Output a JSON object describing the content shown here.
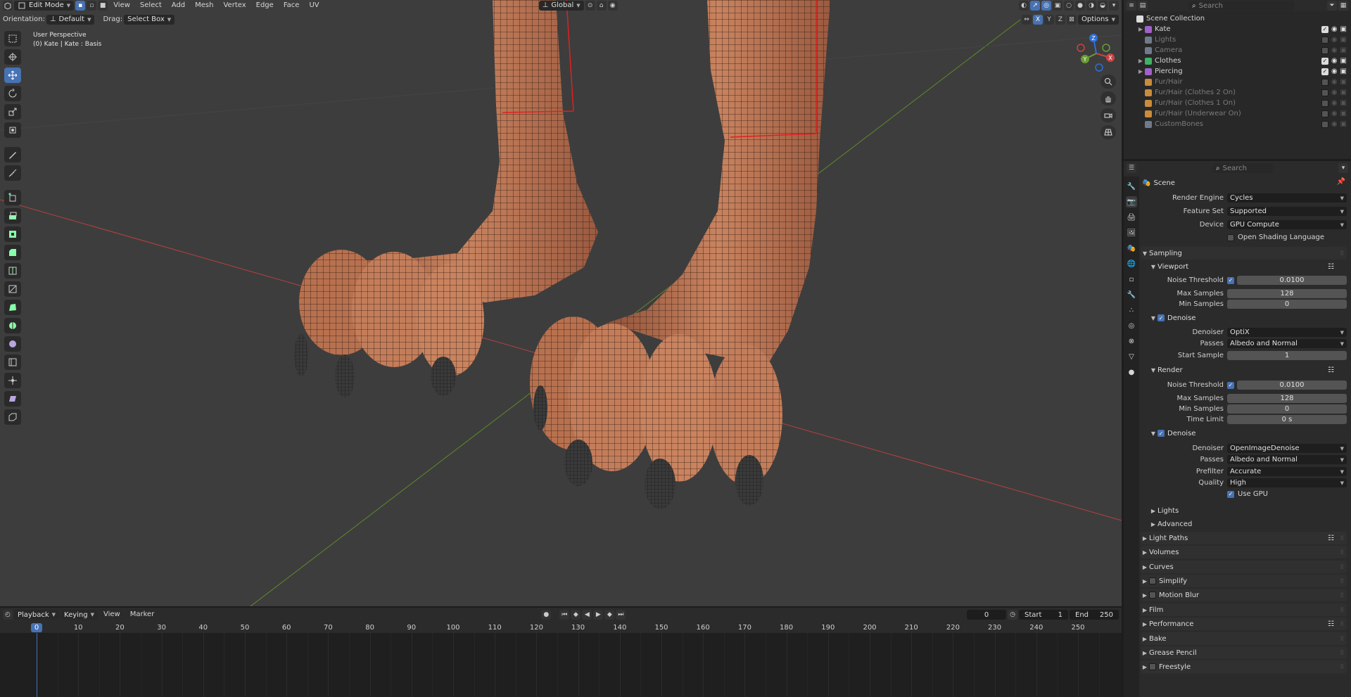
{
  "viewport": {
    "header": {
      "editor_icon": "cube-icon",
      "mode": "Edit Mode",
      "menus": [
        "View",
        "Select",
        "Add",
        "Mesh",
        "Vertex",
        "Edge",
        "Face",
        "UV"
      ],
      "transform_orientation": "Global"
    },
    "tool_header": {
      "orientation_label": "Orientation:",
      "orientation_value": "Default",
      "drag_label": "Drag:",
      "drag_value": "Select Box",
      "options_label": "Options",
      "mirror_x": "X",
      "mirror_y": "Y",
      "mirror_z": "Z"
    },
    "overlay": {
      "perspective": "User Perspective",
      "object_info": "(0) Kate | Kate : Basis"
    },
    "gizmo": {
      "x": "X",
      "y": "Y",
      "z": "Z"
    }
  },
  "timeline": {
    "menus": [
      "Playback",
      "Keying",
      "View",
      "Marker"
    ],
    "current_frame": "0",
    "start_label": "Start",
    "start_value": "1",
    "end_label": "End",
    "end_value": "250",
    "ruler_ticks": [
      "0",
      "10",
      "20",
      "30",
      "40",
      "50",
      "60",
      "70",
      "80",
      "90",
      "100",
      "110",
      "120",
      "130",
      "140",
      "150",
      "160",
      "170",
      "180",
      "190",
      "200",
      "210",
      "220",
      "230",
      "240",
      "250"
    ]
  },
  "outliner": {
    "search_placeholder": "Search",
    "root": "Scene Collection",
    "items": [
      {
        "label": "Kate",
        "color": "#a061c9",
        "dim": false,
        "expandable": true
      },
      {
        "label": "Lights",
        "color": "#6f7a8c",
        "dim": true,
        "expandable": false
      },
      {
        "label": "Camera",
        "color": "#6f7a8c",
        "dim": true,
        "expandable": false
      },
      {
        "label": "Clothes",
        "color": "#3fb264",
        "dim": false,
        "expandable": true
      },
      {
        "label": "Piercing",
        "color": "#a061c9",
        "dim": false,
        "expandable": true
      },
      {
        "label": "Fur/Hair",
        "color": "#c98b3c",
        "dim": true,
        "expandable": false
      },
      {
        "label": "Fur/Hair (Clothes 2 On)",
        "color": "#c98b3c",
        "dim": true,
        "expandable": false
      },
      {
        "label": "Fur/Hair (Clothes 1 On)",
        "color": "#c98b3c",
        "dim": true,
        "expandable": false
      },
      {
        "label": "Fur/Hair (Underwear On)",
        "color": "#c98b3c",
        "dim": true,
        "expandable": false
      },
      {
        "label": "CustomBones",
        "color": "#6f7a8c",
        "dim": true,
        "expandable": false
      }
    ]
  },
  "properties": {
    "search_placeholder": "Search",
    "context": "Scene",
    "render_engine_label": "Render Engine",
    "render_engine": "Cycles",
    "feature_set_label": "Feature Set",
    "feature_set": "Supported",
    "device_label": "Device",
    "device": "GPU Compute",
    "osl_label": "Open Shading Language",
    "sampling": "Sampling",
    "viewport": "Viewport",
    "vp_noise_threshold_label": "Noise Threshold",
    "vp_noise_threshold": "0.0100",
    "vp_max_samples_label": "Max Samples",
    "vp_max_samples": "128",
    "vp_min_samples_label": "Min Samples",
    "vp_min_samples": "0",
    "vp_denoise": "Denoise",
    "vp_denoiser_label": "Denoiser",
    "vp_denoiser": "OptiX",
    "vp_passes_label": "Passes",
    "vp_passes": "Albedo and Normal",
    "vp_start_sample_label": "Start Sample",
    "vp_start_sample": "1",
    "render": "Render",
    "r_noise_threshold_label": "Noise Threshold",
    "r_noise_threshold": "0.0100",
    "r_max_samples_label": "Max Samples",
    "r_max_samples": "128",
    "r_min_samples_label": "Min Samples",
    "r_min_samples": "0",
    "r_time_limit_label": "Time Limit",
    "r_time_limit": "0 s",
    "r_denoise": "Denoise",
    "r_denoiser_label": "Denoiser",
    "r_denoiser": "OpenImageDenoise",
    "r_passes_label": "Passes",
    "r_passes": "Albedo and Normal",
    "r_prefilter_label": "Prefilter",
    "r_prefilter": "Accurate",
    "r_quality_label": "Quality",
    "r_quality": "High",
    "r_use_gpu": "Use GPU",
    "lights": "Lights",
    "advanced": "Advanced",
    "light_paths": "Light Paths",
    "volumes": "Volumes",
    "curves": "Curves",
    "simplify": "Simplify",
    "motion_blur": "Motion Blur",
    "film": "Film",
    "performance": "Performance",
    "bake": "Bake",
    "grease_pencil": "Grease Pencil",
    "freestyle": "Freestyle"
  },
  "colors": {
    "accent": "#4772b3",
    "skin": "#c07a5a",
    "axis_x": "#b84040",
    "axis_y": "#5f8a2a"
  }
}
